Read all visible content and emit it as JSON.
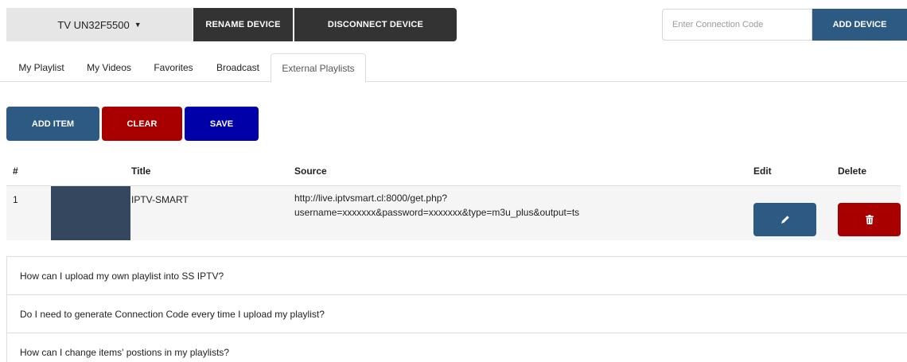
{
  "device": {
    "name": "TV UN32F5500",
    "caret": "▼"
  },
  "toolbar": {
    "rename_label": "RENAME DEVICE",
    "disconnect_label": "DISCONNECT DEVICE"
  },
  "connection": {
    "placeholder": "Enter Connection Code",
    "value": "",
    "add_label": "ADD DEVICE"
  },
  "tabs": [
    {
      "label": "My Playlist",
      "active": false
    },
    {
      "label": "My Videos",
      "active": false
    },
    {
      "label": "Favorites",
      "active": false
    },
    {
      "label": "Broadcast",
      "active": false
    },
    {
      "label": "External Playlists",
      "active": true
    }
  ],
  "actions": {
    "add_item": "ADD ITEM",
    "clear": "CLEAR",
    "save": "SAVE"
  },
  "table": {
    "headers": {
      "num": "#",
      "title": "Title",
      "source": "Source",
      "edit": "Edit",
      "delete": "Delete"
    },
    "rows": [
      {
        "num": "1",
        "title": "IPTV-SMART",
        "source_line1": "http://live.iptvsmart.cl:8000/get.php?",
        "source_line2": "username=xxxxxxx&password=xxxxxxx&type=m3u_plus&output=ts"
      }
    ]
  },
  "icons": {
    "edit": "pencil-icon",
    "delete": "trash-icon",
    "dropdown": "caret-down-icon"
  },
  "faq": [
    "How can I upload my own playlist into SS IPTV?",
    "Do I need to generate Connection Code every time I upload my playlist?",
    "How can I change items' postions in my playlists?"
  ],
  "colors": {
    "primary_blue": "#2c5a82",
    "danger_red": "#a80000",
    "save_blue": "#0000a8",
    "dark": "#333333",
    "thumb": "#34475e"
  }
}
